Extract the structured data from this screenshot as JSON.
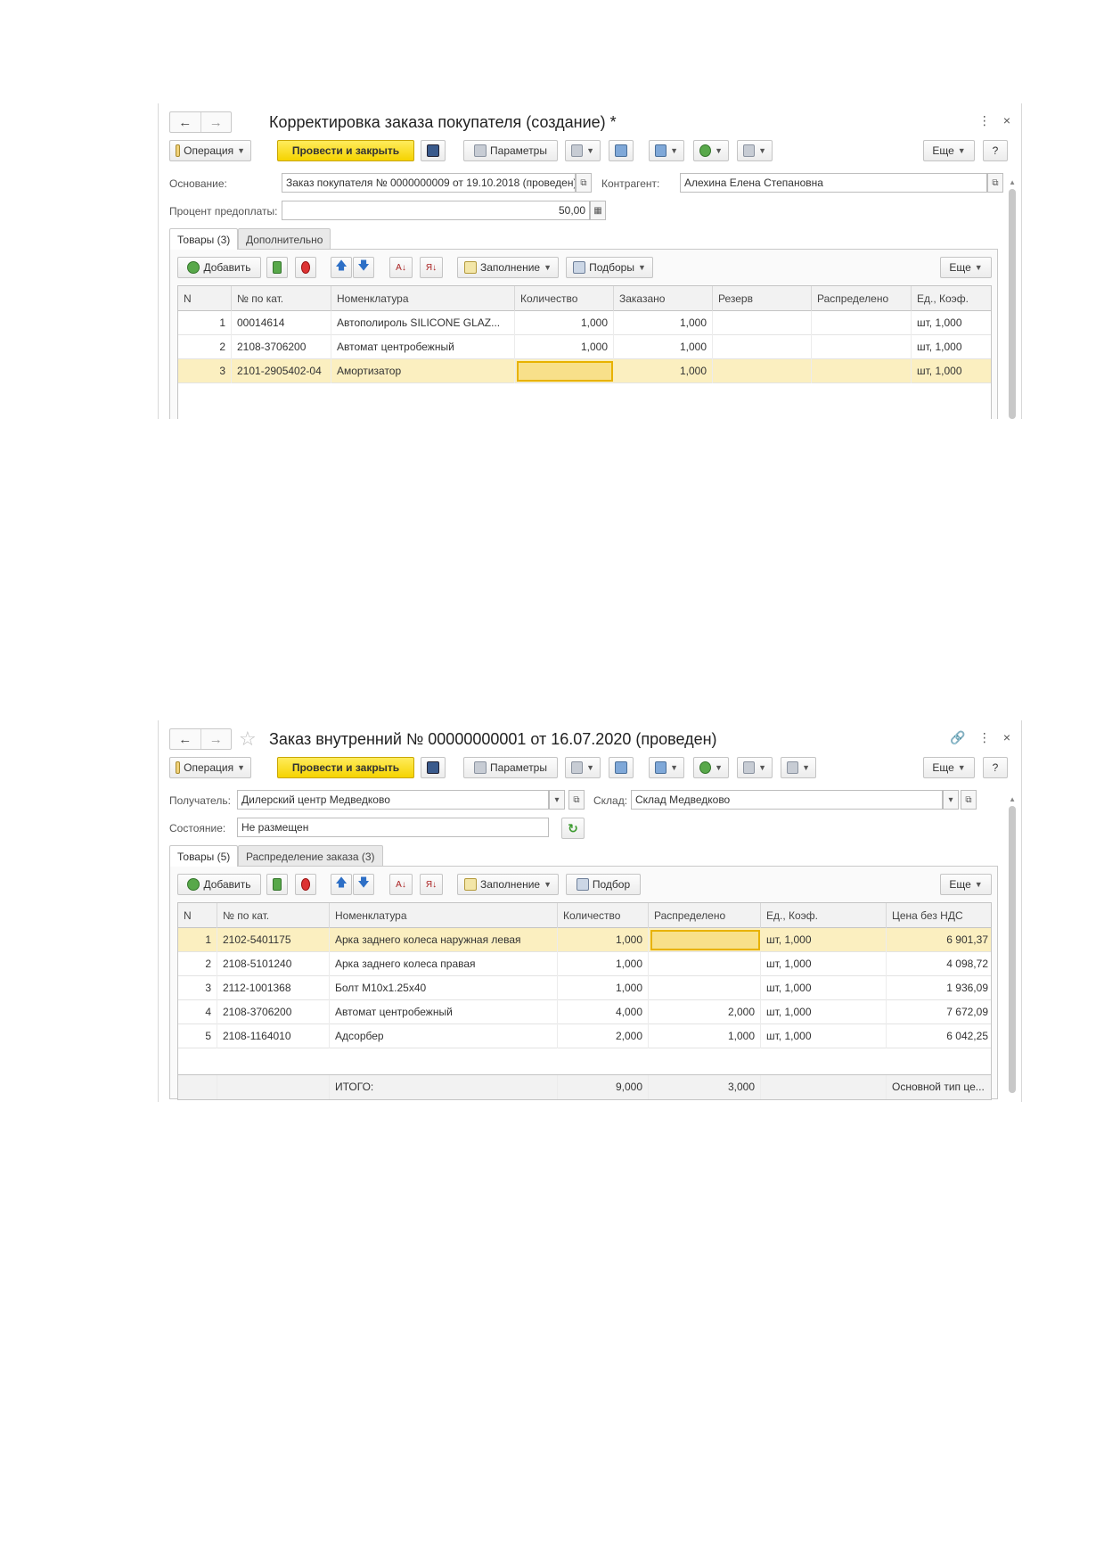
{
  "window1": {
    "title": "Корректировка заказа покупателя (создание) *",
    "toolbar": {
      "operation": "Операция",
      "post_close": "Провести и закрыть",
      "params": "Параметры",
      "more": "Еще",
      "help": "?"
    },
    "basis_label": "Основание:",
    "basis_value": "Заказ покупателя № 0000000009 от 19.10.2018 (проведен)",
    "counterparty_label": "Контрагент:",
    "counterparty_value": "Алехина Елена Степановна",
    "prepay_label": "Процент предоплаты:",
    "prepay_value": "50,00",
    "tabs": [
      "Товары (3)",
      "Дополнительно"
    ],
    "table_toolbar": {
      "add": "Добавить",
      "fill": "Заполнение",
      "pick": "Подборы",
      "more": "Еще"
    },
    "columns": [
      "N",
      "№ по кат.",
      "Номенклатура",
      "Количество",
      "Заказано",
      "Резерв",
      "Распределено",
      "Ед., Коэф."
    ],
    "rows": [
      {
        "n": "1",
        "cat": "00014614",
        "name": "Автополироль SILICONE GLAZ...",
        "qty": "1,000",
        "ordered": "1,000",
        "reserve": "",
        "distributed": "",
        "unit": "шт, 1,000"
      },
      {
        "n": "2",
        "cat": "2108-3706200",
        "name": "Автомат центробежный",
        "qty": "1,000",
        "ordered": "1,000",
        "reserve": "",
        "distributed": "",
        "unit": "шт, 1,000"
      },
      {
        "n": "3",
        "cat": "2101-2905402-04",
        "name": "Амортизатор",
        "qty": "",
        "ordered": "1,000",
        "reserve": "",
        "distributed": "",
        "unit": "шт, 1,000"
      }
    ]
  },
  "window2": {
    "title": "Заказ внутренний № 00000000001 от 16.07.2020 (проведен)",
    "toolbar": {
      "operation": "Операция",
      "post_close": "Провести и закрыть",
      "params": "Параметры",
      "more": "Еще",
      "help": "?"
    },
    "recipient_label": "Получатель:",
    "recipient_value": "Дилерский центр Медведково",
    "warehouse_label": "Склад:",
    "warehouse_value": "Склад Медведково",
    "state_label": "Состояние:",
    "state_value": "Не размещен",
    "tabs": [
      "Товары (5)",
      "Распределение заказа (3)"
    ],
    "table_toolbar": {
      "add": "Добавить",
      "fill": "Заполнение",
      "pick": "Подбор",
      "more": "Еще"
    },
    "columns": [
      "N",
      "№ по кат.",
      "Номенклатура",
      "Количество",
      "Распределено",
      "Ед., Коэф.",
      "Цена без НДС"
    ],
    "rows": [
      {
        "n": "1",
        "cat": "2102-5401175",
        "name": "Арка заднего колеса наружная левая",
        "qty": "1,000",
        "distributed": "",
        "unit": "шт, 1,000",
        "price": "6 901,37"
      },
      {
        "n": "2",
        "cat": "2108-5101240",
        "name": "Арка заднего колеса правая",
        "qty": "1,000",
        "distributed": "",
        "unit": "шт, 1,000",
        "price": "4 098,72"
      },
      {
        "n": "3",
        "cat": "2112-1001368",
        "name": "Болт М10х1.25х40",
        "qty": "1,000",
        "distributed": "",
        "unit": "шт, 1,000",
        "price": "1 936,09"
      },
      {
        "n": "4",
        "cat": "2108-3706200",
        "name": "Автомат центробежный",
        "qty": "4,000",
        "distributed": "2,000",
        "unit": "шт, 1,000",
        "price": "7 672,09"
      },
      {
        "n": "5",
        "cat": "2108-1164010",
        "name": "Адсорбер",
        "qty": "2,000",
        "distributed": "1,000",
        "unit": "шт, 1,000",
        "price": "6 042,25"
      }
    ],
    "totals": {
      "label": "ИТОГО:",
      "qty": "9,000",
      "distributed": "3,000",
      "price_type": "Основной тип це..."
    }
  }
}
